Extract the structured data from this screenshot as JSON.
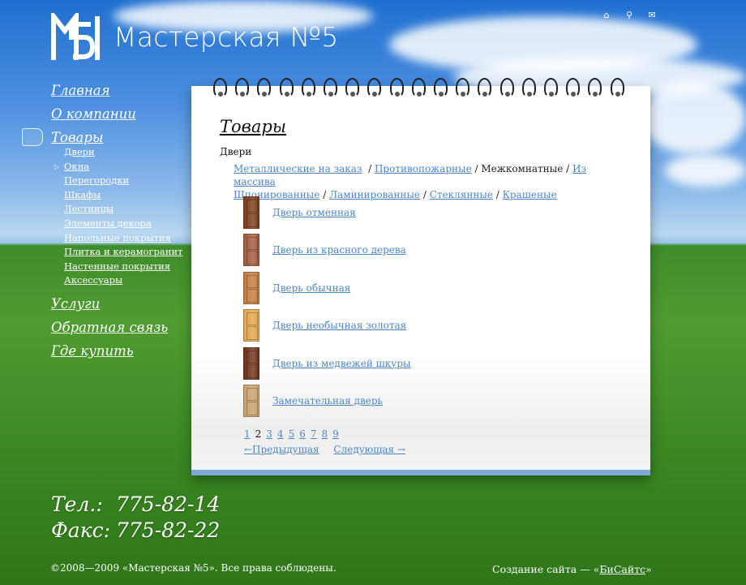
{
  "header": {
    "site_title": "Мастерская №5",
    "logo_icon": "m5-logo-icon",
    "icons": [
      "home-icon",
      "sitemap-icon",
      "mail-icon"
    ]
  },
  "nav": {
    "main": [
      {
        "label": "Главная"
      },
      {
        "label": "О компании"
      },
      {
        "label": "Товары"
      },
      {
        "label": "Услуги"
      },
      {
        "label": "Обратная связь"
      },
      {
        "label": "Где купить"
      }
    ],
    "sub": [
      {
        "label": "Двери"
      },
      {
        "label": "Окна"
      },
      {
        "label": "Перегородки"
      },
      {
        "label": "Шкафы"
      },
      {
        "label": "Лестницы"
      },
      {
        "label": "Элементы декора"
      },
      {
        "label": "Напольные покрытия"
      },
      {
        "label": "Плитка и керамогранит"
      },
      {
        "label": "Настенные покрытия"
      },
      {
        "label": "Аксессуары"
      }
    ]
  },
  "content": {
    "heading": "Товары",
    "crumb": "Двери",
    "categories": [
      {
        "label": "Металлические на заказ",
        "active": false
      },
      {
        "label": "Противопожарные",
        "active": false
      },
      {
        "label": "Межкомнатные",
        "active": true
      },
      {
        "label": "Из массива",
        "active": false
      },
      {
        "label": "Шпонированные",
        "active": false
      },
      {
        "label": "Ламинированные",
        "active": false
      },
      {
        "label": "Стеклянные",
        "active": false
      },
      {
        "label": "Крашеные",
        "active": false
      }
    ],
    "products": [
      {
        "label": "Дверь отменная",
        "color": "#7a3b16"
      },
      {
        "label": "Дверь из красного дерева",
        "color": "#a0583a"
      },
      {
        "label": "Дверь обычная",
        "color": "#c27a3a"
      },
      {
        "label": "Дверь необычная золотая",
        "color": "#e0a448"
      },
      {
        "label": "Дверь из медвежей шкуры",
        "color": "#6e2f15"
      },
      {
        "label": "Замечательная дверь",
        "color": "#caa06a"
      }
    ],
    "pages": [
      "1",
      "2",
      "3",
      "4",
      "5",
      "6",
      "7",
      "8",
      "9"
    ],
    "current_page": "2",
    "prev_label": "←Предыдущая",
    "next_label": "Следующая →"
  },
  "footer": {
    "phone_label": "Тел.:",
    "phone": "775-82-14",
    "fax_label": "Факс:",
    "fax": "775-82-22",
    "copyright": "©2008—2009 «Мастерская №5». Все права соблюдены.",
    "credits_prefix": "Создание сайта — «",
    "credits_link": "БиСайтс",
    "credits_suffix": "»"
  }
}
